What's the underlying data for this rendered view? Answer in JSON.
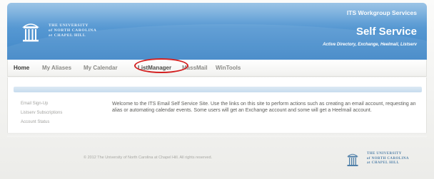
{
  "header": {
    "logo_lines": [
      "THE UNIVERSITY",
      "of NORTH CAROLINA",
      "at CHAPEL HILL"
    ],
    "service_group": "ITS Workgroup Services",
    "service_title": "Self Service",
    "service_subtitle": "Active Directory, Exchange, Heelmail, Listserv"
  },
  "nav": {
    "items": [
      {
        "label": "Home"
      },
      {
        "label": "My Aliases"
      },
      {
        "label": "My Calendar"
      },
      {
        "label": "ListManager"
      },
      {
        "label": "MassMail"
      },
      {
        "label": "WinTools"
      }
    ]
  },
  "sidebar": {
    "links": [
      {
        "label": "Email Sign-Up"
      },
      {
        "label": "Listserv Subscriptions"
      },
      {
        "label": "Account Status"
      }
    ]
  },
  "main": {
    "welcome_text": "Welcome to the ITS Email Self Service Site. Use the links on this site to perform actions such as creating an email account, requesting an alias or automating calendar events. Some users will get an Exchange account and some will get a Heelmail account."
  },
  "footer": {
    "copyright": "© 2012 The University of North Carolina at Chapel Hill. All rights reserved.",
    "logo_lines": [
      "THE UNIVERSITY",
      "of NORTH CAROLINA",
      "at CHAPEL HILL"
    ]
  },
  "colors": {
    "header_blue": "#3f86c7",
    "highlight_circle": "#d32020",
    "footer_logo": "#4f7fa8"
  },
  "icons": {
    "header_logo": "old-well-icon",
    "footer_logo": "old-well-icon"
  }
}
